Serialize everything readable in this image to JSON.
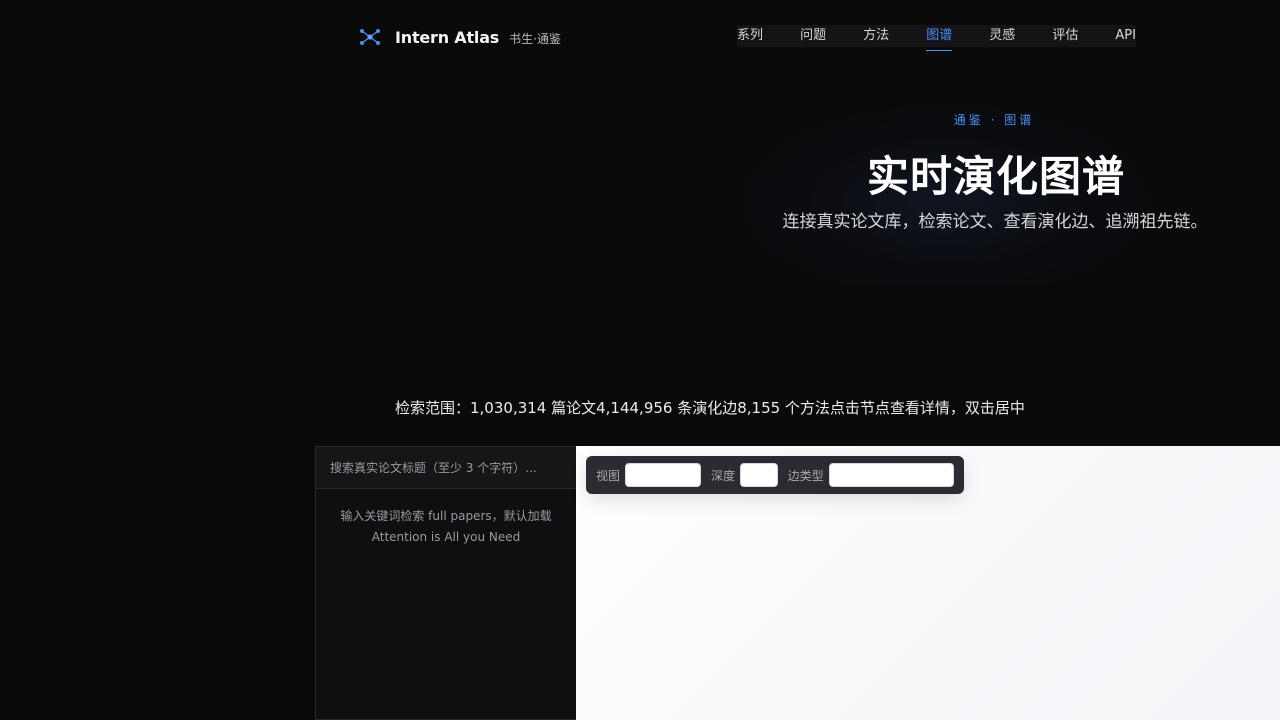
{
  "brand": {
    "name": "Intern Atlas",
    "subtitle": "书生·通鉴"
  },
  "nav": {
    "items": [
      {
        "label": "系列"
      },
      {
        "label": "问题"
      },
      {
        "label": "方法"
      },
      {
        "label": "图谱",
        "active": true
      },
      {
        "label": "灵感"
      },
      {
        "label": "评估"
      },
      {
        "label": "API"
      }
    ],
    "active_color": "#4d8df7"
  },
  "hero": {
    "eyebrow": "通鉴 · 图谱",
    "title": "实时演化图谱",
    "subtitle": "连接真实论文库，检索论文、查看演化边、追溯祖先链。"
  },
  "stats": {
    "text": "检索范围：1,030,314 篇论文4,144,956 条演化边8,155 个方法点击节点查看详情，双击居中"
  },
  "search": {
    "placeholder": "搜索真实论文标题（至少 3 个字符）...",
    "value": "",
    "hint": "输入关键词检索 full papers，默认加载 Attention is All you Need"
  },
  "toolbar": {
    "view_label": "视图",
    "view_value": "",
    "depth_label": "深度",
    "depth_value": "",
    "edge_type_label": "边类型",
    "edge_type_value": ""
  }
}
